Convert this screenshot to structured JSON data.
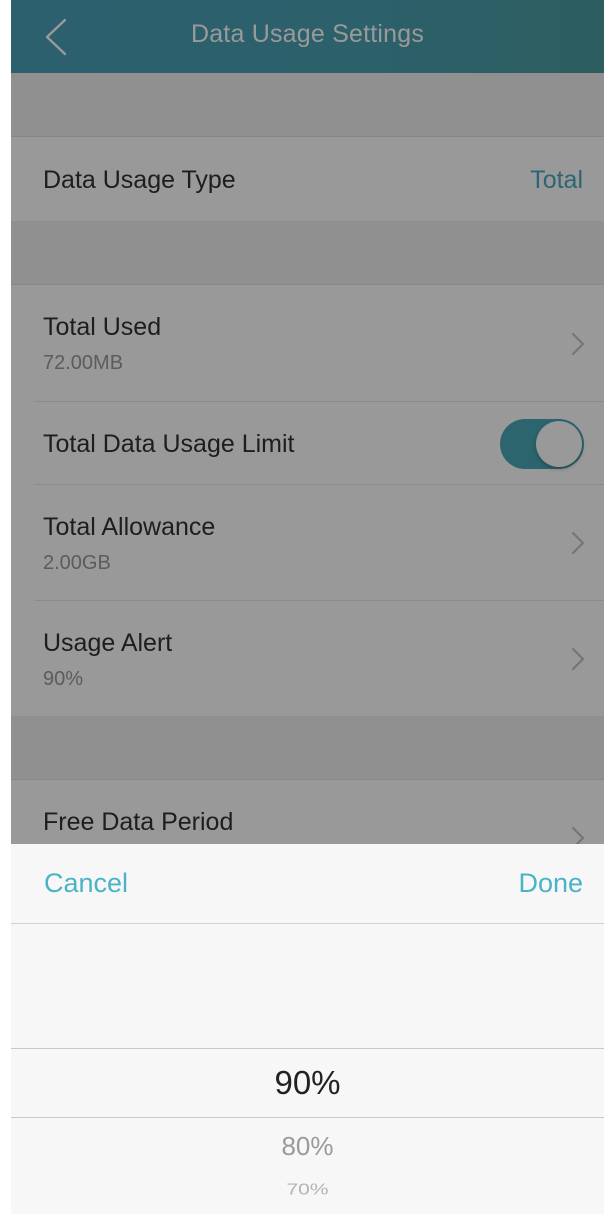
{
  "header": {
    "title": "Data Usage Settings",
    "back_icon": "chevron-left-icon"
  },
  "rows": {
    "data_usage_type": {
      "title": "Data Usage Type",
      "value": "Total"
    },
    "total_used": {
      "title": "Total Used",
      "value": "72.00MB"
    },
    "total_limit": {
      "title": "Total Data Usage Limit",
      "enabled": true
    },
    "total_allowance": {
      "title": "Total Allowance",
      "value": "2.00GB"
    },
    "usage_alert": {
      "title": "Usage Alert",
      "value": "90%"
    },
    "free_period": {
      "title": "Free Data Period"
    }
  },
  "picker": {
    "cancel_label": "Cancel",
    "done_label": "Done",
    "selected": "90%",
    "options_below": [
      "80%",
      "70%"
    ]
  },
  "colors": {
    "header_start": "#4ba0b8",
    "header_end": "#4a9c9f",
    "accent": "#4ab3c6",
    "toggle_on": "#4aa8b8"
  }
}
